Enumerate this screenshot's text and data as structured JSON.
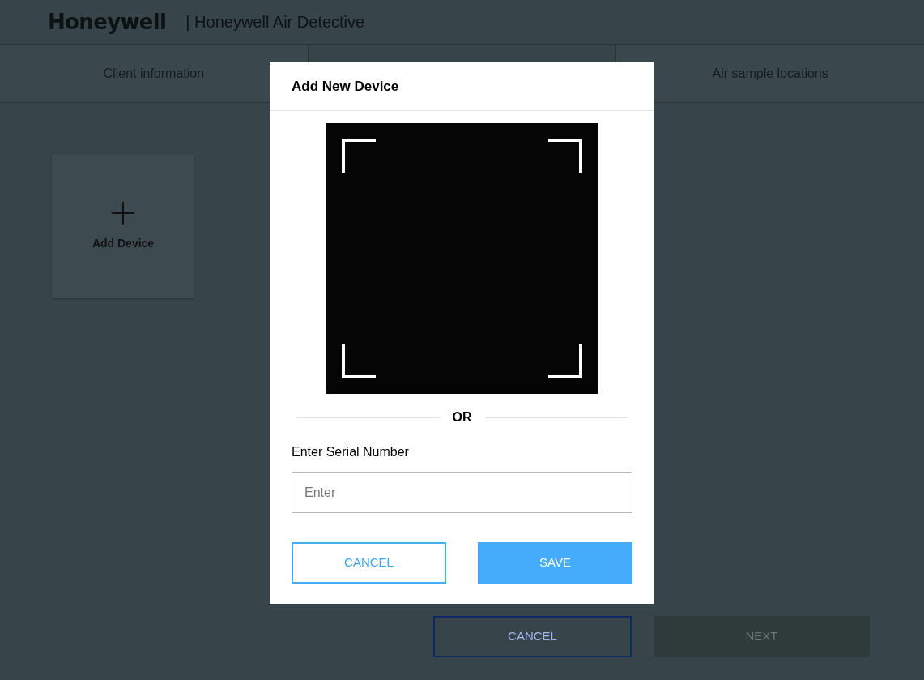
{
  "header": {
    "logo": "Honeywell",
    "title": "| Honeywell Air Detective"
  },
  "tabs": [
    {
      "label": "Client information"
    },
    {
      "covered": true
    },
    {
      "label": "Air sample locations"
    }
  ],
  "add_card": {
    "label": "Add Device"
  },
  "modal": {
    "title": "Add New Device",
    "divider_text": "OR",
    "serial_label": "Enter Serial Number",
    "serial_placeholder": "Enter",
    "buttons": [
      {
        "label": "CANCEL",
        "kind": "outline"
      },
      {
        "label": "SAVE",
        "kind": "primary"
      }
    ]
  },
  "footer": {
    "buttons": [
      {
        "label": "CANCEL",
        "kind": "outline",
        "disabled": false
      },
      {
        "label": "NEXT",
        "kind": "primary",
        "disabled": true
      }
    ]
  }
}
